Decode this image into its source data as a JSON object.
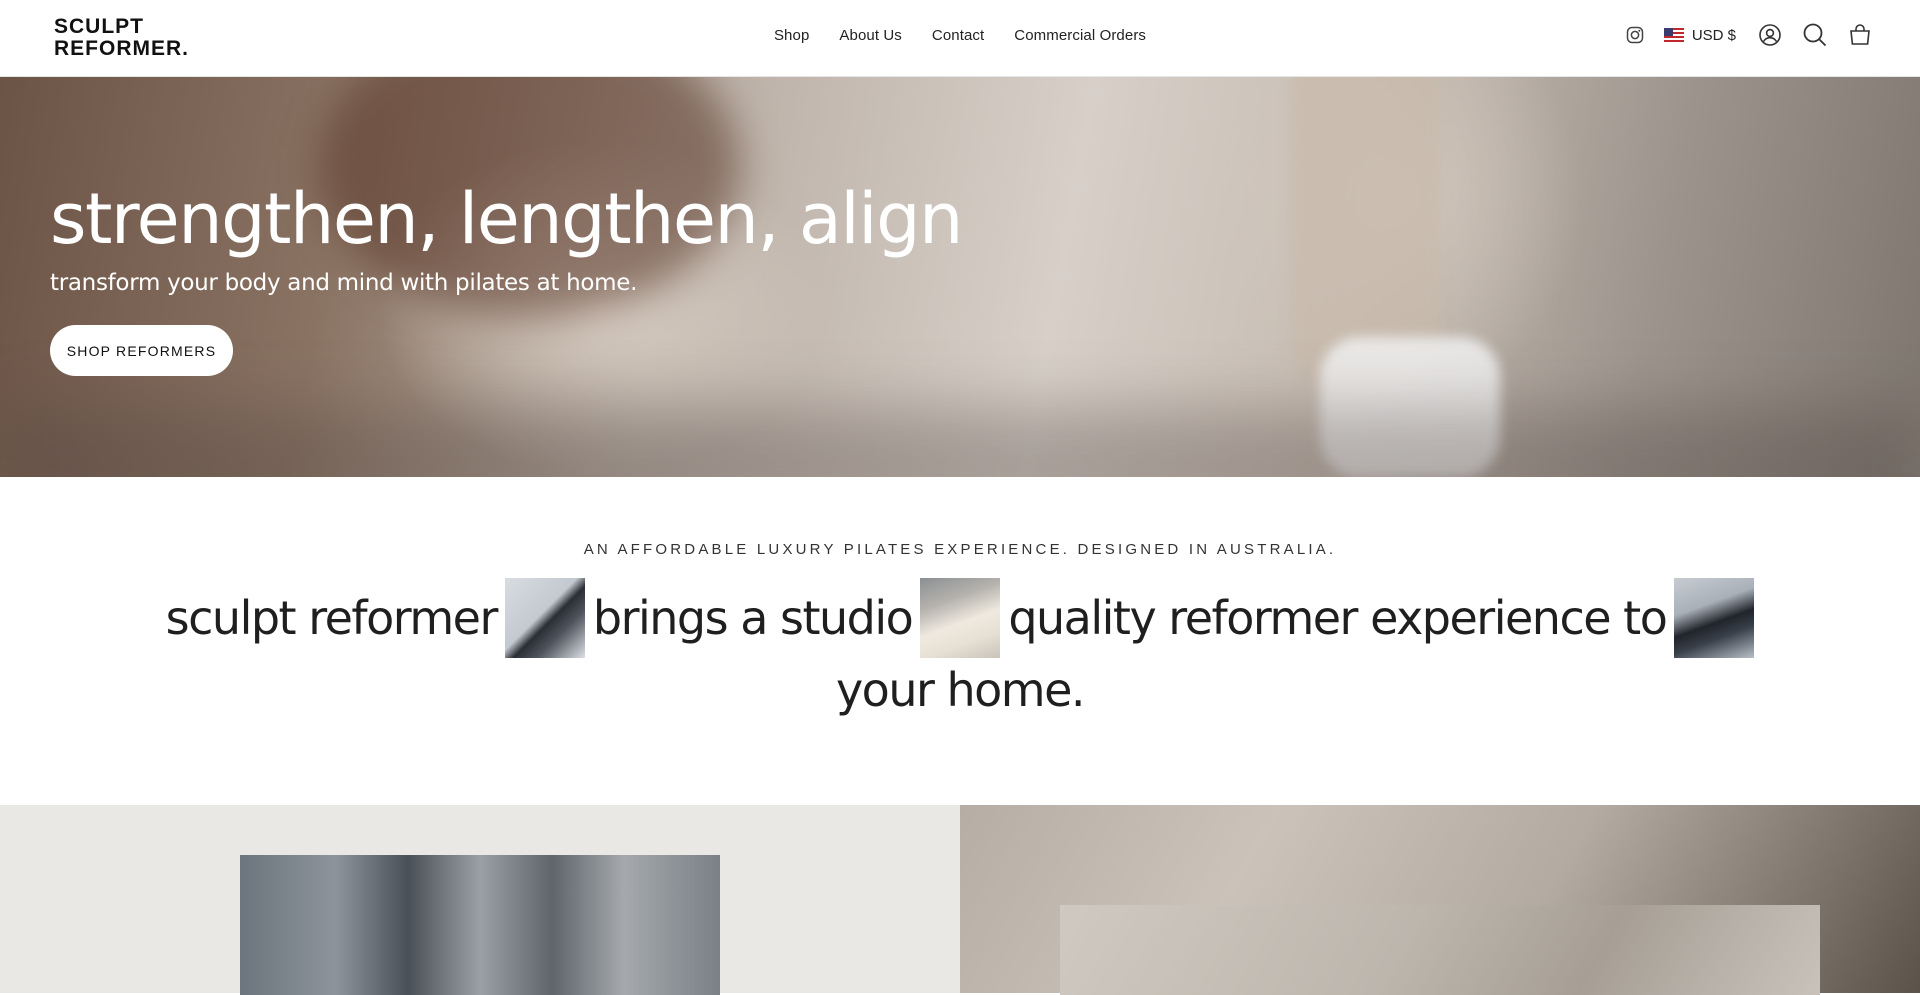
{
  "header": {
    "logo_line1": "SCULPT",
    "logo_line2": "REFORMER.",
    "nav": [
      "Shop",
      "About Us",
      "Contact",
      "Commercial Orders"
    ],
    "currency": "USD $",
    "icons": [
      "instagram-icon",
      "us-flag-icon",
      "account-icon",
      "search-icon",
      "cart-icon"
    ]
  },
  "hero": {
    "headline": "strengthen, lengthen, align",
    "subheadline": "transform your body and mind with pilates at home.",
    "cta": "SHOP REFORMERS"
  },
  "intro": {
    "eyebrow": "AN AFFORDABLE LUXURY PILATES EXPERIENCE. DESIGNED IN AUSTRALIA.",
    "seg1": "sculpt reformer",
    "seg2": "brings a studio",
    "seg3": "quality reformer experience to",
    "seg4": "your home."
  },
  "colors": {
    "text": "#1a1a1a",
    "hero_text": "#ffffff",
    "panel_bg": "#eae8e4"
  }
}
